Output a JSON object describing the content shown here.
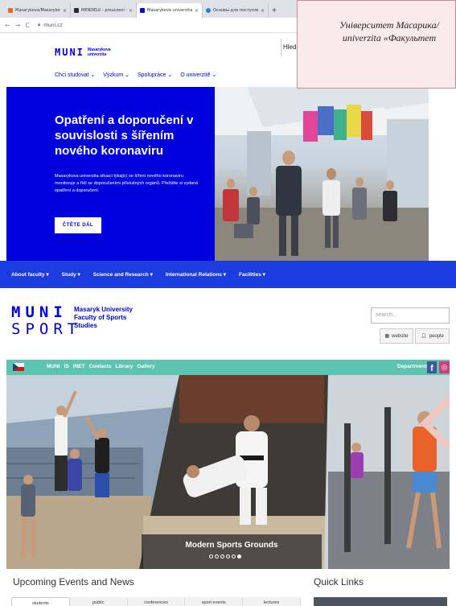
{
  "browser": {
    "tabs": [
      {
        "title": "Masarykova/Masarykova universi",
        "favicon_color": "#e36b2c",
        "active": false
      },
      {
        "title": "MENDELU - prouczeni ekonomi",
        "favicon_color": "#2b2b2b",
        "active": false
      },
      {
        "title": "Masarykova univerzita",
        "favicon_color": "#0000dc",
        "active": true
      },
      {
        "title": "Основы для поступления в вуз",
        "favicon_color": "#2a7de1",
        "active": false
      }
    ],
    "new_tab": "+",
    "close": "×",
    "back": "←",
    "forward": "→",
    "reload": "C",
    "url": "muni.cz"
  },
  "mu": {
    "logo_big": "MUNI",
    "logo_small_1": "Masarykova",
    "logo_small_2": "univerzita",
    "search_label": "Hledej",
    "nav": [
      "Chci studovat",
      "Výzkum",
      "Spolupráce",
      "O univerzitě"
    ],
    "hero_title": "Opatření a doporučení v souvislosti s šířením nového koronaviru",
    "hero_text": "Masarykova univerzita situaci týkající se šíření nového koronaviru monitoruje a řídí se doporučeními příslušných orgánů. Přečtěte si vydaná opatření a doporučení.",
    "hero_button": "ČTĚTE DÁL",
    "brand_color": "#0000dc"
  },
  "caption": {
    "line1": "Університет Масарика/",
    "line2": "univerzita «Факультет"
  },
  "fsps": {
    "nav": [
      "About faculty",
      "Study",
      "Science and Research",
      "International Relations",
      "Facilities"
    ],
    "logo_line1": "MUNI",
    "logo_line2": "SPORT",
    "name_1": "Masaryk University",
    "name_2": "Faculty of Sports",
    "name_3": "Studies",
    "search_placeholder": "search...",
    "website_btn": "website",
    "people_btn": "people",
    "quick_links_bar": [
      "MUNI",
      "IS",
      "INET",
      "Contacts",
      "Library",
      "Gallery"
    ],
    "departments": "Departments",
    "facebook": "f",
    "instagram": "◎",
    "slide_caption": "Modern Sports Grounds",
    "slide_count": 6,
    "active_slide": 6,
    "events_title": "Upcoming Events and News",
    "quick_title": "Quick Links",
    "event_tabs": [
      "students",
      "public",
      "conferences",
      "sport events",
      "lectures"
    ],
    "nav_color": "#1d3ce0",
    "teal_color": "#5cc4b0"
  }
}
